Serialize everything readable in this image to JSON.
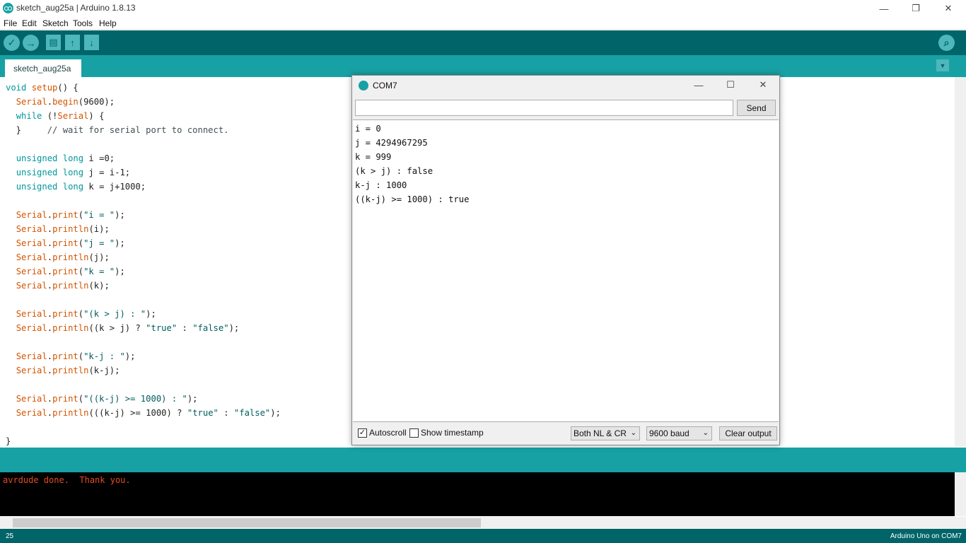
{
  "window": {
    "title": "sketch_aug25a | Arduino 1.8.13",
    "minimize": "—",
    "restore": "❐",
    "close": "✕"
  },
  "menu": [
    "File",
    "Edit",
    "Sketch",
    "Tools",
    "Help"
  ],
  "toolbar": {
    "verify": "✓",
    "upload": "→",
    "new": "▤",
    "open": "↑",
    "save": "↓",
    "serial_monitor": "⌕"
  },
  "tabs": [
    {
      "label": "sketch_aug25a"
    }
  ],
  "tab_menu": "▼",
  "console": {
    "text": "avrdude done.  Thank you."
  },
  "status": {
    "line": "25",
    "board": "Arduino Uno on COM7"
  },
  "serial_monitor": {
    "title": "COM7",
    "input_value": "",
    "send_label": "Send",
    "output": [
      "i = 0",
      "j = 4294967295",
      "k = 999",
      "(k > j) : false",
      "k-j : 1000",
      "((k-j) >= 1000) : true"
    ],
    "autoscroll_label": "Autoscroll",
    "autoscroll_checked": "✓",
    "timestamp_label": "Show timestamp",
    "line_ending": "Both NL & CR",
    "baud": "9600 baud",
    "clear_label": "Clear output",
    "minimize": "—",
    "maximize": "☐",
    "close": "✕"
  },
  "colors": {
    "teal_dark": "#006468",
    "teal": "#17a1a5",
    "keyword": "#00979c",
    "function": "#d35400",
    "console_text": "#e34c26"
  }
}
